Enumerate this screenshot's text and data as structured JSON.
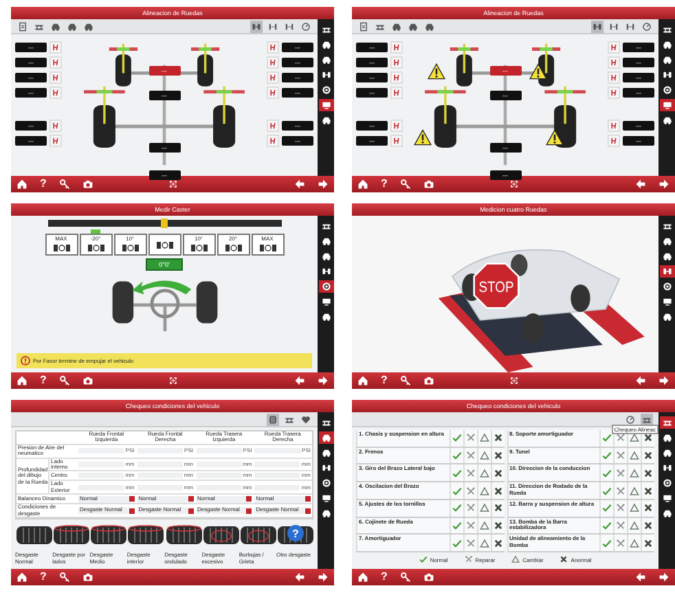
{
  "screens": [
    {
      "kind": "alignment",
      "title": "Alineacion de Ruedas",
      "warnings": false,
      "toolbar_left": [
        {
          "kind": "document",
          "selected": false
        },
        {
          "kind": "lift",
          "selected": false
        },
        {
          "kind": "car",
          "selected": false
        },
        {
          "kind": "car",
          "selected": false
        },
        {
          "kind": "car",
          "selected": false
        }
      ],
      "toolbar_right": [
        {
          "kind": "wheels",
          "selected": true
        },
        {
          "kind": "axle",
          "selected": false
        },
        {
          "kind": "axle",
          "selected": false
        },
        {
          "kind": "dial",
          "selected": false
        }
      ],
      "left_readings": [
        "---",
        "---",
        "---",
        "---",
        "---",
        "---"
      ],
      "right_readings": [
        "---",
        "---",
        "---",
        "---",
        "---",
        "---"
      ],
      "center_readings": [
        "---",
        "---",
        "---",
        "---"
      ],
      "sidebar": [
        {
          "kind": "lift",
          "selected": false
        },
        {
          "kind": "car",
          "selected": false
        },
        {
          "kind": "car",
          "selected": false
        },
        {
          "kind": "wheels",
          "selected": false
        },
        {
          "kind": "wheel",
          "selected": false
        },
        {
          "kind": "monitor",
          "selected": true
        },
        {
          "kind": "car",
          "selected": false
        }
      ],
      "footer": [
        {
          "kind": "home"
        },
        {
          "kind": "help",
          "label": "?"
        },
        {
          "kind": "key"
        },
        {
          "kind": "camera"
        },
        {
          "kind": "arrows"
        },
        {
          "kind": "back"
        },
        {
          "kind": "next"
        }
      ]
    },
    {
      "kind": "alignment",
      "title": "Alineacion de Ruedas",
      "warnings": true,
      "toolbar_left": [
        {
          "kind": "document",
          "selected": false
        },
        {
          "kind": "lift",
          "selected": false
        },
        {
          "kind": "car",
          "selected": false
        },
        {
          "kind": "car",
          "selected": false
        },
        {
          "kind": "car",
          "selected": false
        }
      ],
      "toolbar_right": [
        {
          "kind": "wheels",
          "selected": true
        },
        {
          "kind": "axle",
          "selected": false
        },
        {
          "kind": "axle",
          "selected": false
        },
        {
          "kind": "dial",
          "selected": false
        }
      ],
      "left_readings": [
        "---",
        "---",
        "---",
        "---",
        "---",
        "---"
      ],
      "right_readings": [
        "---",
        "---",
        "---",
        "---",
        "---",
        "---"
      ],
      "center_readings": [
        "---",
        "---",
        "---",
        "---"
      ],
      "sidebar": [
        {
          "kind": "lift",
          "selected": false
        },
        {
          "kind": "car",
          "selected": false
        },
        {
          "kind": "car",
          "selected": false
        },
        {
          "kind": "wheels",
          "selected": false
        },
        {
          "kind": "wheel",
          "selected": false
        },
        {
          "kind": "monitor",
          "selected": true
        },
        {
          "kind": "car",
          "selected": false
        }
      ],
      "footer": [
        {
          "kind": "home"
        },
        {
          "kind": "help",
          "label": "?"
        },
        {
          "kind": "key"
        },
        {
          "kind": "camera"
        },
        {
          "kind": "arrows"
        },
        {
          "kind": "back"
        },
        {
          "kind": "next"
        }
      ]
    },
    {
      "kind": "caster",
      "title": "Medir Caster",
      "level": 0.5,
      "steps": [
        {
          "label": "MAX",
          "selected": false
        },
        {
          "label": "-20°",
          "selected": true
        },
        {
          "label": "10°",
          "selected": false
        },
        {
          "selected": false
        },
        {
          "label": "10°",
          "selected": false
        },
        {
          "label": "20°",
          "selected": false
        },
        {
          "label": "MAX",
          "selected": false
        }
      ],
      "value": "0°0'",
      "message": "Por Favor termine de empujar el vehiculo",
      "sidebar": [
        {
          "kind": "lift",
          "selected": false
        },
        {
          "kind": "car",
          "selected": false
        },
        {
          "kind": "car",
          "selected": false
        },
        {
          "kind": "wheels",
          "selected": false
        },
        {
          "kind": "wheel",
          "selected": true
        },
        {
          "kind": "monitor",
          "selected": false
        },
        {
          "kind": "car",
          "selected": false
        }
      ],
      "footer": [
        {
          "kind": "home"
        },
        {
          "kind": "help",
          "label": "?"
        },
        {
          "kind": "key"
        },
        {
          "kind": "camera"
        },
        {
          "kind": "arrows"
        },
        {
          "kind": "back"
        },
        {
          "kind": "next"
        }
      ]
    },
    {
      "kind": "stop",
      "title": "Medicion cuatro Ruedas",
      "sign": "STOP",
      "sidebar": [
        {
          "kind": "lift",
          "selected": false
        },
        {
          "kind": "car",
          "selected": false
        },
        {
          "kind": "car",
          "selected": false
        },
        {
          "kind": "wheels",
          "selected": true
        },
        {
          "kind": "wheel",
          "selected": false
        },
        {
          "kind": "monitor",
          "selected": false
        },
        {
          "kind": "car",
          "selected": false
        }
      ],
      "footer": [
        {
          "kind": "home"
        },
        {
          "kind": "help",
          "label": "?"
        },
        {
          "kind": "key"
        },
        {
          "kind": "camera"
        },
        {
          "kind": "arrows"
        },
        {
          "kind": "back"
        },
        {
          "kind": "next"
        }
      ]
    },
    {
      "kind": "tires",
      "title": "Chequeo condiciones del vehiculo",
      "toolbar_right": [
        {
          "kind": "tire",
          "selected": true
        },
        {
          "kind": "lift",
          "selected": false
        },
        {
          "kind": "heart",
          "selected": false
        }
      ],
      "columns": [
        "Rueda Frontal Izquierda",
        "Rueda Frontal Derecha",
        "Rueda Trasera Izquierda",
        "Rueda Trasera Derecha"
      ],
      "rows": [
        {
          "kind": "input",
          "label": "Presion de Aire del neumatico",
          "cells": [
            "PSI",
            "PSI",
            "PSI",
            "PSI"
          ]
        },
        {
          "kind": "group",
          "label": "Profundidad del dibujo de la Rueda",
          "children": [
            {
              "label": "Lado interno",
              "cells": [
                "mm",
                "mm",
                "mm",
                "mm"
              ]
            },
            {
              "label": "Centro",
              "cells": [
                "mm",
                "mm",
                "mm",
                "mm"
              ]
            },
            {
              "label": "Lado Exterior",
              "cells": [
                "mm",
                "mm",
                "mm",
                "mm"
              ]
            }
          ]
        },
        {
          "kind": "select",
          "label": "Balanceo Dinamico",
          "cells": [
            "Normal",
            "Normal",
            "Normal",
            "Normal"
          ]
        },
        {
          "kind": "select",
          "label": "Condiciones de desgaste",
          "cells": [
            "Desgaste Normal",
            "Desgaste Normal",
            "Desgaste Normal",
            "Desgaste Normal"
          ]
        }
      ],
      "tires": [
        {
          "label": "Desgaste Normal",
          "kind": "plain"
        },
        {
          "label": "Desgaste por lados",
          "kind": "edge"
        },
        {
          "label": "Desgaste Medio",
          "kind": "edge"
        },
        {
          "label": "Desgaste interior",
          "kind": "edge"
        },
        {
          "label": "Desgaste ondulado",
          "kind": "edge"
        },
        {
          "label": "Desgaste excesivo",
          "kind": "center"
        },
        {
          "label": "Burbujas / Grieta",
          "kind": "center"
        },
        {
          "label": "Otro desgaste",
          "kind": "plain",
          "badge": "?"
        }
      ],
      "sidebar": [
        {
          "kind": "lift",
          "selected": false
        },
        {
          "kind": "car",
          "selected": true
        },
        {
          "kind": "car",
          "selected": false
        },
        {
          "kind": "wheels",
          "selected": false
        },
        {
          "kind": "wheel",
          "selected": false
        },
        {
          "kind": "monitor",
          "selected": false
        },
        {
          "kind": "car",
          "selected": false
        }
      ],
      "footer": [
        {
          "kind": "home"
        },
        {
          "kind": "help",
          "label": "?"
        },
        {
          "kind": "key"
        },
        {
          "kind": "camera"
        },
        {
          "kind": "back"
        },
        {
          "kind": "next"
        }
      ]
    },
    {
      "kind": "checks",
      "title": "Chequeo condiciones del vehiculo",
      "toolbar_right": [
        {
          "kind": "dial",
          "selected": false
        },
        {
          "kind": "lift",
          "selected": true
        }
      ],
      "tooltip": "Chequeo Alineac",
      "check_columns": [
        {
          "items": [
            "1. Chasis y suspension en altura",
            "2. Frenos",
            "3. Giro del Brazo Lateral bajo",
            "4. Oscilacion del Brazo",
            "5. Ajustes de los tornillos",
            "6. Cojinete de Rueda",
            "7. Amortiguador"
          ]
        },
        {
          "items": [
            "8. Soporte amortiguador",
            "9. Tunel",
            "10. Direccion de la conduccion",
            "11. Direccion de Rodado de la Rueda",
            "12. Barra y suspension de altura",
            "13. Bomba de la Barra estabilizadora",
            "Unidad de alineamiento de la Bomba"
          ]
        }
      ],
      "legend": [
        {
          "kind": "ok",
          "label": "Normal"
        },
        {
          "kind": "repair",
          "label": "Reparar"
        },
        {
          "kind": "replace",
          "label": "Cambiar"
        },
        {
          "kind": "fault",
          "label": "Anormal"
        }
      ],
      "sidebar": [
        {
          "kind": "lift",
          "selected": true
        },
        {
          "kind": "car",
          "selected": false
        },
        {
          "kind": "car",
          "selected": false
        },
        {
          "kind": "wheels",
          "selected": false
        },
        {
          "kind": "wheel",
          "selected": false
        },
        {
          "kind": "monitor",
          "selected": false
        },
        {
          "kind": "car",
          "selected": false
        }
      ],
      "footer": [
        {
          "kind": "home"
        },
        {
          "kind": "help",
          "label": "?"
        },
        {
          "kind": "key"
        },
        {
          "kind": "camera"
        },
        {
          "kind": "back"
        },
        {
          "kind": "next"
        }
      ]
    }
  ]
}
